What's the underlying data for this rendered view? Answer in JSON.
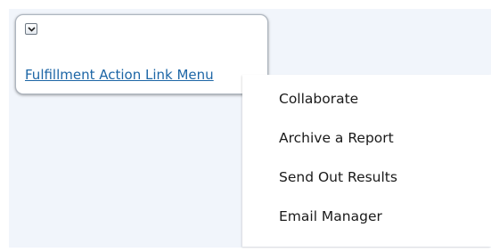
{
  "panel": {
    "link_label": "Fulfillment Action Link Menu",
    "toggle_icon": "chevron-down-icon"
  },
  "menu": {
    "items": [
      {
        "label": "Collaborate"
      },
      {
        "label": "Archive a Report"
      },
      {
        "label": "Send Out Results"
      },
      {
        "label": "Email Manager"
      }
    ]
  },
  "colors": {
    "link": "#1d66a6",
    "background": "#f1f5fb",
    "menu_text": "#1a1a1a"
  }
}
